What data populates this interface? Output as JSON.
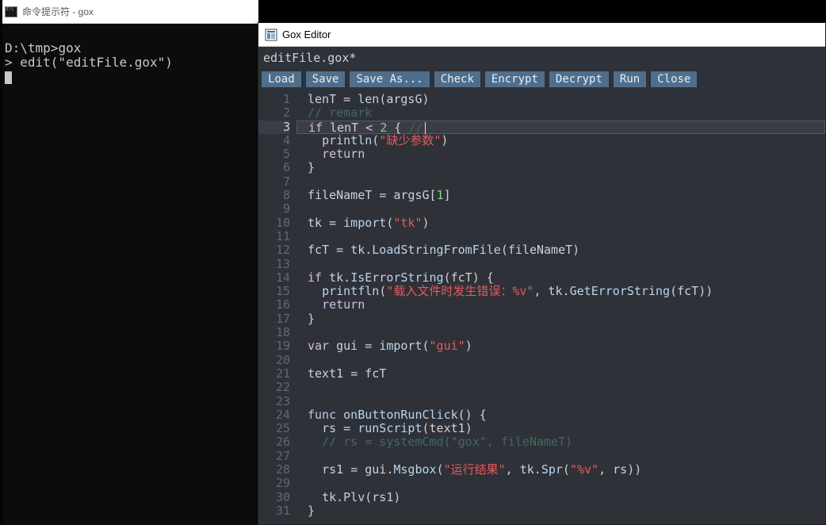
{
  "terminal": {
    "title": "命令提示符 - gox",
    "lines": [
      {
        "prompt": "D:\\tmp>",
        "cmd": "gox"
      },
      {
        "prompt": "> ",
        "cmd": "edit(\"editFile.gox\")"
      }
    ]
  },
  "editor": {
    "title": "Gox Editor",
    "filename": "editFile.gox*",
    "toolbar": {
      "load": "Load",
      "save": "Save",
      "saveas": "Save As...",
      "check": "Check",
      "encrypt": "Encrypt",
      "decrypt": "Decrypt",
      "run": "Run",
      "close": "Close"
    },
    "current_line": 3,
    "line_count": 31,
    "lines": [
      [
        {
          "t": "id",
          "v": "lenT "
        },
        {
          "t": "op",
          "v": "= "
        },
        {
          "t": "fn",
          "v": "len"
        },
        {
          "t": "pun",
          "v": "("
        },
        {
          "t": "id",
          "v": "argsG"
        },
        {
          "t": "pun",
          "v": ")"
        }
      ],
      [
        {
          "t": "cmt",
          "v": "// remark"
        }
      ],
      [
        {
          "t": "kw",
          "v": "if"
        },
        {
          "t": "id",
          "v": " lenT "
        },
        {
          "t": "op",
          "v": "< "
        },
        {
          "t": "num",
          "v": "2"
        },
        {
          "t": "pun",
          "v": " { "
        },
        {
          "t": "cmt",
          "v": "//"
        }
      ],
      [
        {
          "t": "pad",
          "v": "  "
        },
        {
          "t": "fn",
          "v": "println"
        },
        {
          "t": "pun",
          "v": "("
        },
        {
          "t": "str",
          "v": "\"缺少参数\""
        },
        {
          "t": "pun",
          "v": ")"
        }
      ],
      [
        {
          "t": "pad",
          "v": "  "
        },
        {
          "t": "kw",
          "v": "return"
        }
      ],
      [
        {
          "t": "pun",
          "v": "}"
        }
      ],
      [],
      [
        {
          "t": "id",
          "v": "fileNameT "
        },
        {
          "t": "op",
          "v": "= "
        },
        {
          "t": "id",
          "v": "argsG"
        },
        {
          "t": "pun",
          "v": "["
        },
        {
          "t": "num",
          "v": "1"
        },
        {
          "t": "pun",
          "v": "]"
        }
      ],
      [],
      [
        {
          "t": "id",
          "v": "tk "
        },
        {
          "t": "op",
          "v": "= "
        },
        {
          "t": "fn",
          "v": "import"
        },
        {
          "t": "pun",
          "v": "("
        },
        {
          "t": "str",
          "v": "\"tk\""
        },
        {
          "t": "pun",
          "v": ")"
        }
      ],
      [],
      [
        {
          "t": "id",
          "v": "fcT "
        },
        {
          "t": "op",
          "v": "= "
        },
        {
          "t": "id",
          "v": "tk"
        },
        {
          "t": "pun",
          "v": "."
        },
        {
          "t": "fn",
          "v": "LoadStringFromFile"
        },
        {
          "t": "pun",
          "v": "("
        },
        {
          "t": "id",
          "v": "fileNameT"
        },
        {
          "t": "pun",
          "v": ")"
        }
      ],
      [],
      [
        {
          "t": "kw",
          "v": "if"
        },
        {
          "t": "id",
          "v": " tk"
        },
        {
          "t": "pun",
          "v": "."
        },
        {
          "t": "fn",
          "v": "IsErrorString"
        },
        {
          "t": "pun",
          "v": "("
        },
        {
          "t": "id",
          "v": "fcT"
        },
        {
          "t": "pun",
          "v": ") {"
        }
      ],
      [
        {
          "t": "pad",
          "v": "  "
        },
        {
          "t": "fn",
          "v": "printfln"
        },
        {
          "t": "pun",
          "v": "("
        },
        {
          "t": "str",
          "v": "\"载入文件时发生错误：%v\""
        },
        {
          "t": "pun",
          "v": ", "
        },
        {
          "t": "id",
          "v": "tk"
        },
        {
          "t": "pun",
          "v": "."
        },
        {
          "t": "fn",
          "v": "GetErrorString"
        },
        {
          "t": "pun",
          "v": "("
        },
        {
          "t": "id",
          "v": "fcT"
        },
        {
          "t": "pun",
          "v": "))"
        }
      ],
      [
        {
          "t": "pad",
          "v": "  "
        },
        {
          "t": "kw",
          "v": "return"
        }
      ],
      [
        {
          "t": "pun",
          "v": "}"
        }
      ],
      [],
      [
        {
          "t": "kw",
          "v": "var"
        },
        {
          "t": "id",
          "v": " gui "
        },
        {
          "t": "op",
          "v": "= "
        },
        {
          "t": "fn",
          "v": "import"
        },
        {
          "t": "pun",
          "v": "("
        },
        {
          "t": "str",
          "v": "\"gui\""
        },
        {
          "t": "pun",
          "v": ")"
        }
      ],
      [],
      [
        {
          "t": "id",
          "v": "text1 "
        },
        {
          "t": "op",
          "v": "= "
        },
        {
          "t": "id",
          "v": "fcT"
        }
      ],
      [],
      [],
      [
        {
          "t": "kw",
          "v": "func"
        },
        {
          "t": "fn",
          "v": " onButtonRunClick"
        },
        {
          "t": "pun",
          "v": "() {"
        }
      ],
      [
        {
          "t": "pad",
          "v": "  "
        },
        {
          "t": "id",
          "v": "rs "
        },
        {
          "t": "op",
          "v": "= "
        },
        {
          "t": "fn",
          "v": "runScript"
        },
        {
          "t": "pun",
          "v": "("
        },
        {
          "t": "id",
          "v": "text1"
        },
        {
          "t": "pun",
          "v": ")"
        }
      ],
      [
        {
          "t": "pad",
          "v": "  "
        },
        {
          "t": "cmt",
          "v": "// rs = systemCmd(\"gox\", fileNameT)"
        }
      ],
      [],
      [
        {
          "t": "pad",
          "v": "  "
        },
        {
          "t": "id",
          "v": "rs1 "
        },
        {
          "t": "op",
          "v": "= "
        },
        {
          "t": "id",
          "v": "gui"
        },
        {
          "t": "pun",
          "v": "."
        },
        {
          "t": "fn",
          "v": "Msgbox"
        },
        {
          "t": "pun",
          "v": "("
        },
        {
          "t": "str",
          "v": "\"运行结果\""
        },
        {
          "t": "pun",
          "v": ", "
        },
        {
          "t": "id",
          "v": "tk"
        },
        {
          "t": "pun",
          "v": "."
        },
        {
          "t": "fn",
          "v": "Spr"
        },
        {
          "t": "pun",
          "v": "("
        },
        {
          "t": "str",
          "v": "\"%v\""
        },
        {
          "t": "pun",
          "v": ", "
        },
        {
          "t": "id",
          "v": "rs"
        },
        {
          "t": "pun",
          "v": "))"
        }
      ],
      [],
      [
        {
          "t": "pad",
          "v": "  "
        },
        {
          "t": "id",
          "v": "tk"
        },
        {
          "t": "pun",
          "v": "."
        },
        {
          "t": "fn",
          "v": "Plv"
        },
        {
          "t": "pun",
          "v": "("
        },
        {
          "t": "id",
          "v": "rs1"
        },
        {
          "t": "pun",
          "v": ")"
        }
      ],
      [
        {
          "t": "pun",
          "v": "}"
        }
      ]
    ]
  }
}
